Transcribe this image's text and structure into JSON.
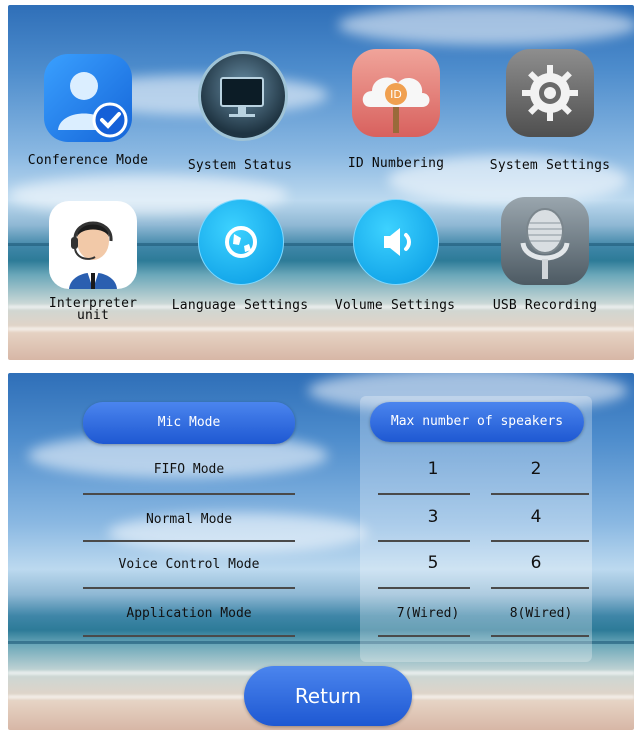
{
  "main_menu": {
    "items": [
      {
        "label": "Conference Mode",
        "icon": "conference-mode-icon"
      },
      {
        "label": "System Status",
        "icon": "monitor-icon"
      },
      {
        "label": "ID Numbering",
        "icon": "id-cloud-icon"
      },
      {
        "label": "System Settings",
        "icon": "gear-icon"
      },
      {
        "label_line1": "Interpreter",
        "label_line2": "unit",
        "icon": "interpreter-headset-icon"
      },
      {
        "label": "Language Settings",
        "icon": "globe-icon"
      },
      {
        "label": "Volume Settings",
        "icon": "speaker-icon"
      },
      {
        "label": "USB Recording",
        "icon": "microphone-icon"
      }
    ]
  },
  "mic_mode": {
    "header": "Mic Mode",
    "options": [
      "FIFO Mode",
      "Normal Mode",
      "Voice Control Mode",
      "Application Mode"
    ]
  },
  "speakers": {
    "header": "Max number of speakers",
    "values": [
      "1",
      "2",
      "3",
      "4",
      "5",
      "6",
      "7(Wired)",
      "8(Wired)"
    ]
  },
  "return_label": "Return",
  "colors": {
    "button_blue": "#1e58d2",
    "text": "#111111"
  }
}
